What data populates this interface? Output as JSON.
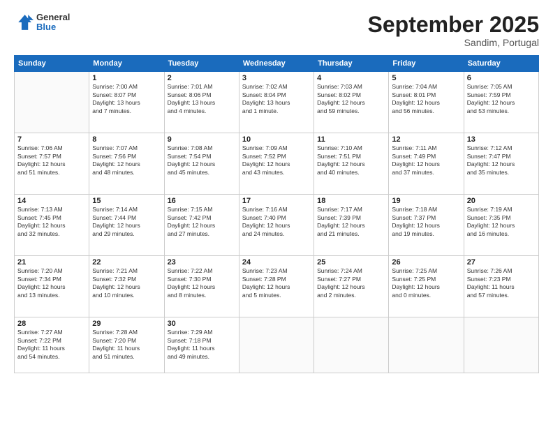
{
  "header": {
    "logo": {
      "line1": "General",
      "line2": "Blue"
    },
    "title": "September 2025",
    "subtitle": "Sandim, Portugal"
  },
  "days_of_week": [
    "Sunday",
    "Monday",
    "Tuesday",
    "Wednesday",
    "Thursday",
    "Friday",
    "Saturday"
  ],
  "weeks": [
    [
      {
        "day": "",
        "info": ""
      },
      {
        "day": "1",
        "info": "Sunrise: 7:00 AM\nSunset: 8:07 PM\nDaylight: 13 hours\nand 7 minutes."
      },
      {
        "day": "2",
        "info": "Sunrise: 7:01 AM\nSunset: 8:06 PM\nDaylight: 13 hours\nand 4 minutes."
      },
      {
        "day": "3",
        "info": "Sunrise: 7:02 AM\nSunset: 8:04 PM\nDaylight: 13 hours\nand 1 minute."
      },
      {
        "day": "4",
        "info": "Sunrise: 7:03 AM\nSunset: 8:02 PM\nDaylight: 12 hours\nand 59 minutes."
      },
      {
        "day": "5",
        "info": "Sunrise: 7:04 AM\nSunset: 8:01 PM\nDaylight: 12 hours\nand 56 minutes."
      },
      {
        "day": "6",
        "info": "Sunrise: 7:05 AM\nSunset: 7:59 PM\nDaylight: 12 hours\nand 53 minutes."
      }
    ],
    [
      {
        "day": "7",
        "info": "Sunrise: 7:06 AM\nSunset: 7:57 PM\nDaylight: 12 hours\nand 51 minutes."
      },
      {
        "day": "8",
        "info": "Sunrise: 7:07 AM\nSunset: 7:56 PM\nDaylight: 12 hours\nand 48 minutes."
      },
      {
        "day": "9",
        "info": "Sunrise: 7:08 AM\nSunset: 7:54 PM\nDaylight: 12 hours\nand 45 minutes."
      },
      {
        "day": "10",
        "info": "Sunrise: 7:09 AM\nSunset: 7:52 PM\nDaylight: 12 hours\nand 43 minutes."
      },
      {
        "day": "11",
        "info": "Sunrise: 7:10 AM\nSunset: 7:51 PM\nDaylight: 12 hours\nand 40 minutes."
      },
      {
        "day": "12",
        "info": "Sunrise: 7:11 AM\nSunset: 7:49 PM\nDaylight: 12 hours\nand 37 minutes."
      },
      {
        "day": "13",
        "info": "Sunrise: 7:12 AM\nSunset: 7:47 PM\nDaylight: 12 hours\nand 35 minutes."
      }
    ],
    [
      {
        "day": "14",
        "info": "Sunrise: 7:13 AM\nSunset: 7:45 PM\nDaylight: 12 hours\nand 32 minutes."
      },
      {
        "day": "15",
        "info": "Sunrise: 7:14 AM\nSunset: 7:44 PM\nDaylight: 12 hours\nand 29 minutes."
      },
      {
        "day": "16",
        "info": "Sunrise: 7:15 AM\nSunset: 7:42 PM\nDaylight: 12 hours\nand 27 minutes."
      },
      {
        "day": "17",
        "info": "Sunrise: 7:16 AM\nSunset: 7:40 PM\nDaylight: 12 hours\nand 24 minutes."
      },
      {
        "day": "18",
        "info": "Sunrise: 7:17 AM\nSunset: 7:39 PM\nDaylight: 12 hours\nand 21 minutes."
      },
      {
        "day": "19",
        "info": "Sunrise: 7:18 AM\nSunset: 7:37 PM\nDaylight: 12 hours\nand 19 minutes."
      },
      {
        "day": "20",
        "info": "Sunrise: 7:19 AM\nSunset: 7:35 PM\nDaylight: 12 hours\nand 16 minutes."
      }
    ],
    [
      {
        "day": "21",
        "info": "Sunrise: 7:20 AM\nSunset: 7:34 PM\nDaylight: 12 hours\nand 13 minutes."
      },
      {
        "day": "22",
        "info": "Sunrise: 7:21 AM\nSunset: 7:32 PM\nDaylight: 12 hours\nand 10 minutes."
      },
      {
        "day": "23",
        "info": "Sunrise: 7:22 AM\nSunset: 7:30 PM\nDaylight: 12 hours\nand 8 minutes."
      },
      {
        "day": "24",
        "info": "Sunrise: 7:23 AM\nSunset: 7:28 PM\nDaylight: 12 hours\nand 5 minutes."
      },
      {
        "day": "25",
        "info": "Sunrise: 7:24 AM\nSunset: 7:27 PM\nDaylight: 12 hours\nand 2 minutes."
      },
      {
        "day": "26",
        "info": "Sunrise: 7:25 AM\nSunset: 7:25 PM\nDaylight: 12 hours\nand 0 minutes."
      },
      {
        "day": "27",
        "info": "Sunrise: 7:26 AM\nSunset: 7:23 PM\nDaylight: 11 hours\nand 57 minutes."
      }
    ],
    [
      {
        "day": "28",
        "info": "Sunrise: 7:27 AM\nSunset: 7:22 PM\nDaylight: 11 hours\nand 54 minutes."
      },
      {
        "day": "29",
        "info": "Sunrise: 7:28 AM\nSunset: 7:20 PM\nDaylight: 11 hours\nand 51 minutes."
      },
      {
        "day": "30",
        "info": "Sunrise: 7:29 AM\nSunset: 7:18 PM\nDaylight: 11 hours\nand 49 minutes."
      },
      {
        "day": "",
        "info": ""
      },
      {
        "day": "",
        "info": ""
      },
      {
        "day": "",
        "info": ""
      },
      {
        "day": "",
        "info": ""
      }
    ]
  ]
}
